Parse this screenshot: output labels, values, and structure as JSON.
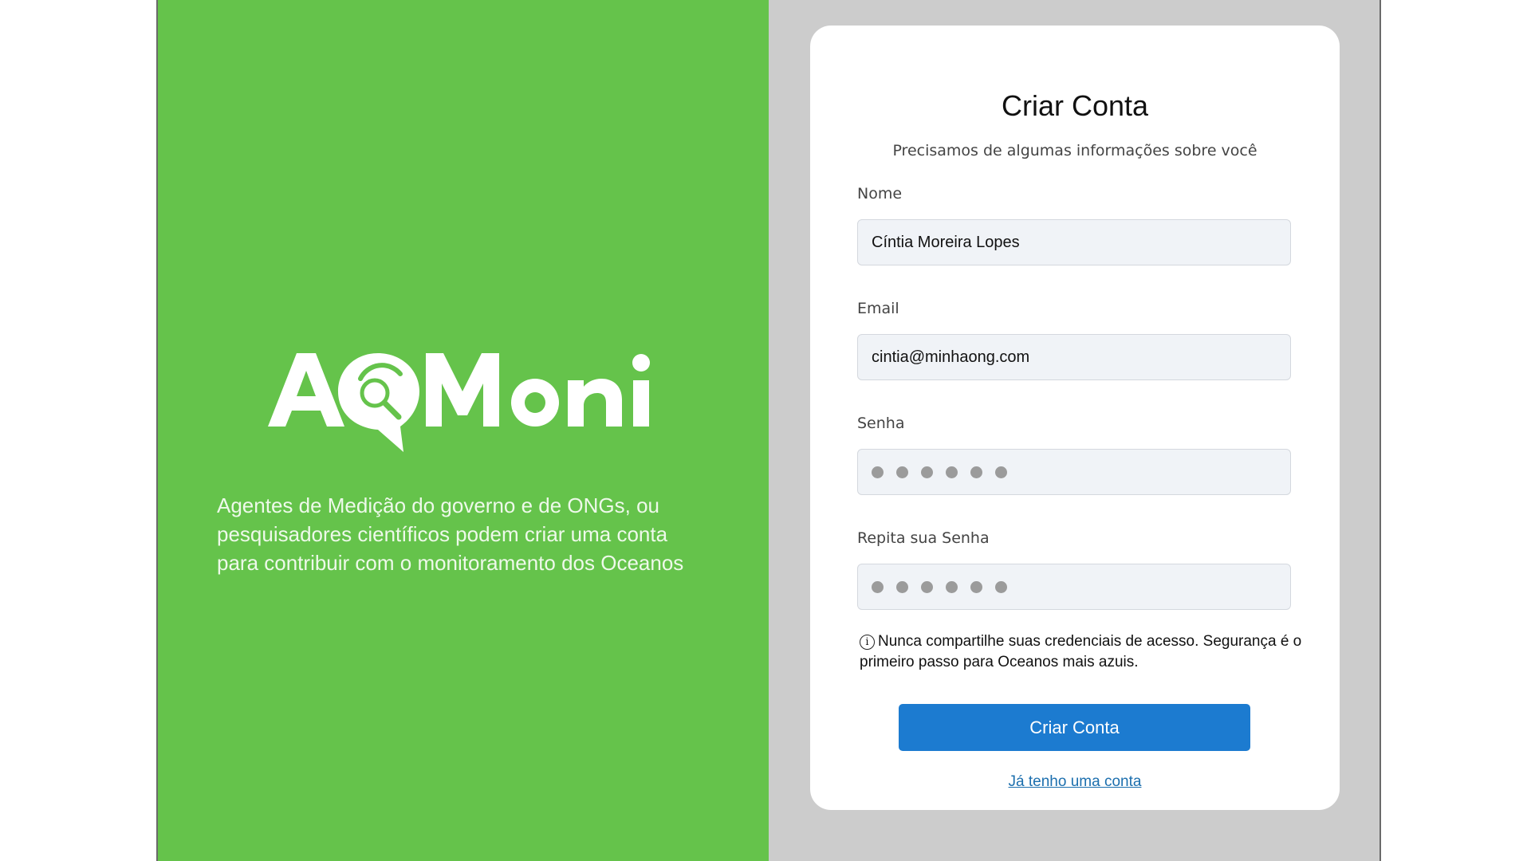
{
  "brand": {
    "logo_text": "AQMoni",
    "tagline": "Agentes de Medição do governo e de ONGs, ou pesquisadores científicos podem criar uma conta para contribuir com o monitoramento dos Oceanos",
    "panel_color": "#65c34b"
  },
  "form": {
    "title": "Criar Conta",
    "subtitle": "Precisamos de algumas informações sobre você",
    "fields": [
      {
        "label": "Nome",
        "value": "Cíntia Moreira Lopes",
        "type": "text"
      },
      {
        "label": "Email",
        "value": "cintia@minhaong.com",
        "type": "email"
      },
      {
        "label": "Senha",
        "value": "••••••",
        "type": "password"
      },
      {
        "label": "Repita sua Senha",
        "value": "••••••",
        "type": "password"
      }
    ],
    "notice": "Nunca compartilhe suas credenciais de acesso. Segurança é o primeiro passo para Oceanos mais azuis.",
    "notice_icon": "info-icon",
    "submit_label": "Criar Conta",
    "login_link": "Já tenho uma conta",
    "accent_color": "#1c7bd0"
  }
}
